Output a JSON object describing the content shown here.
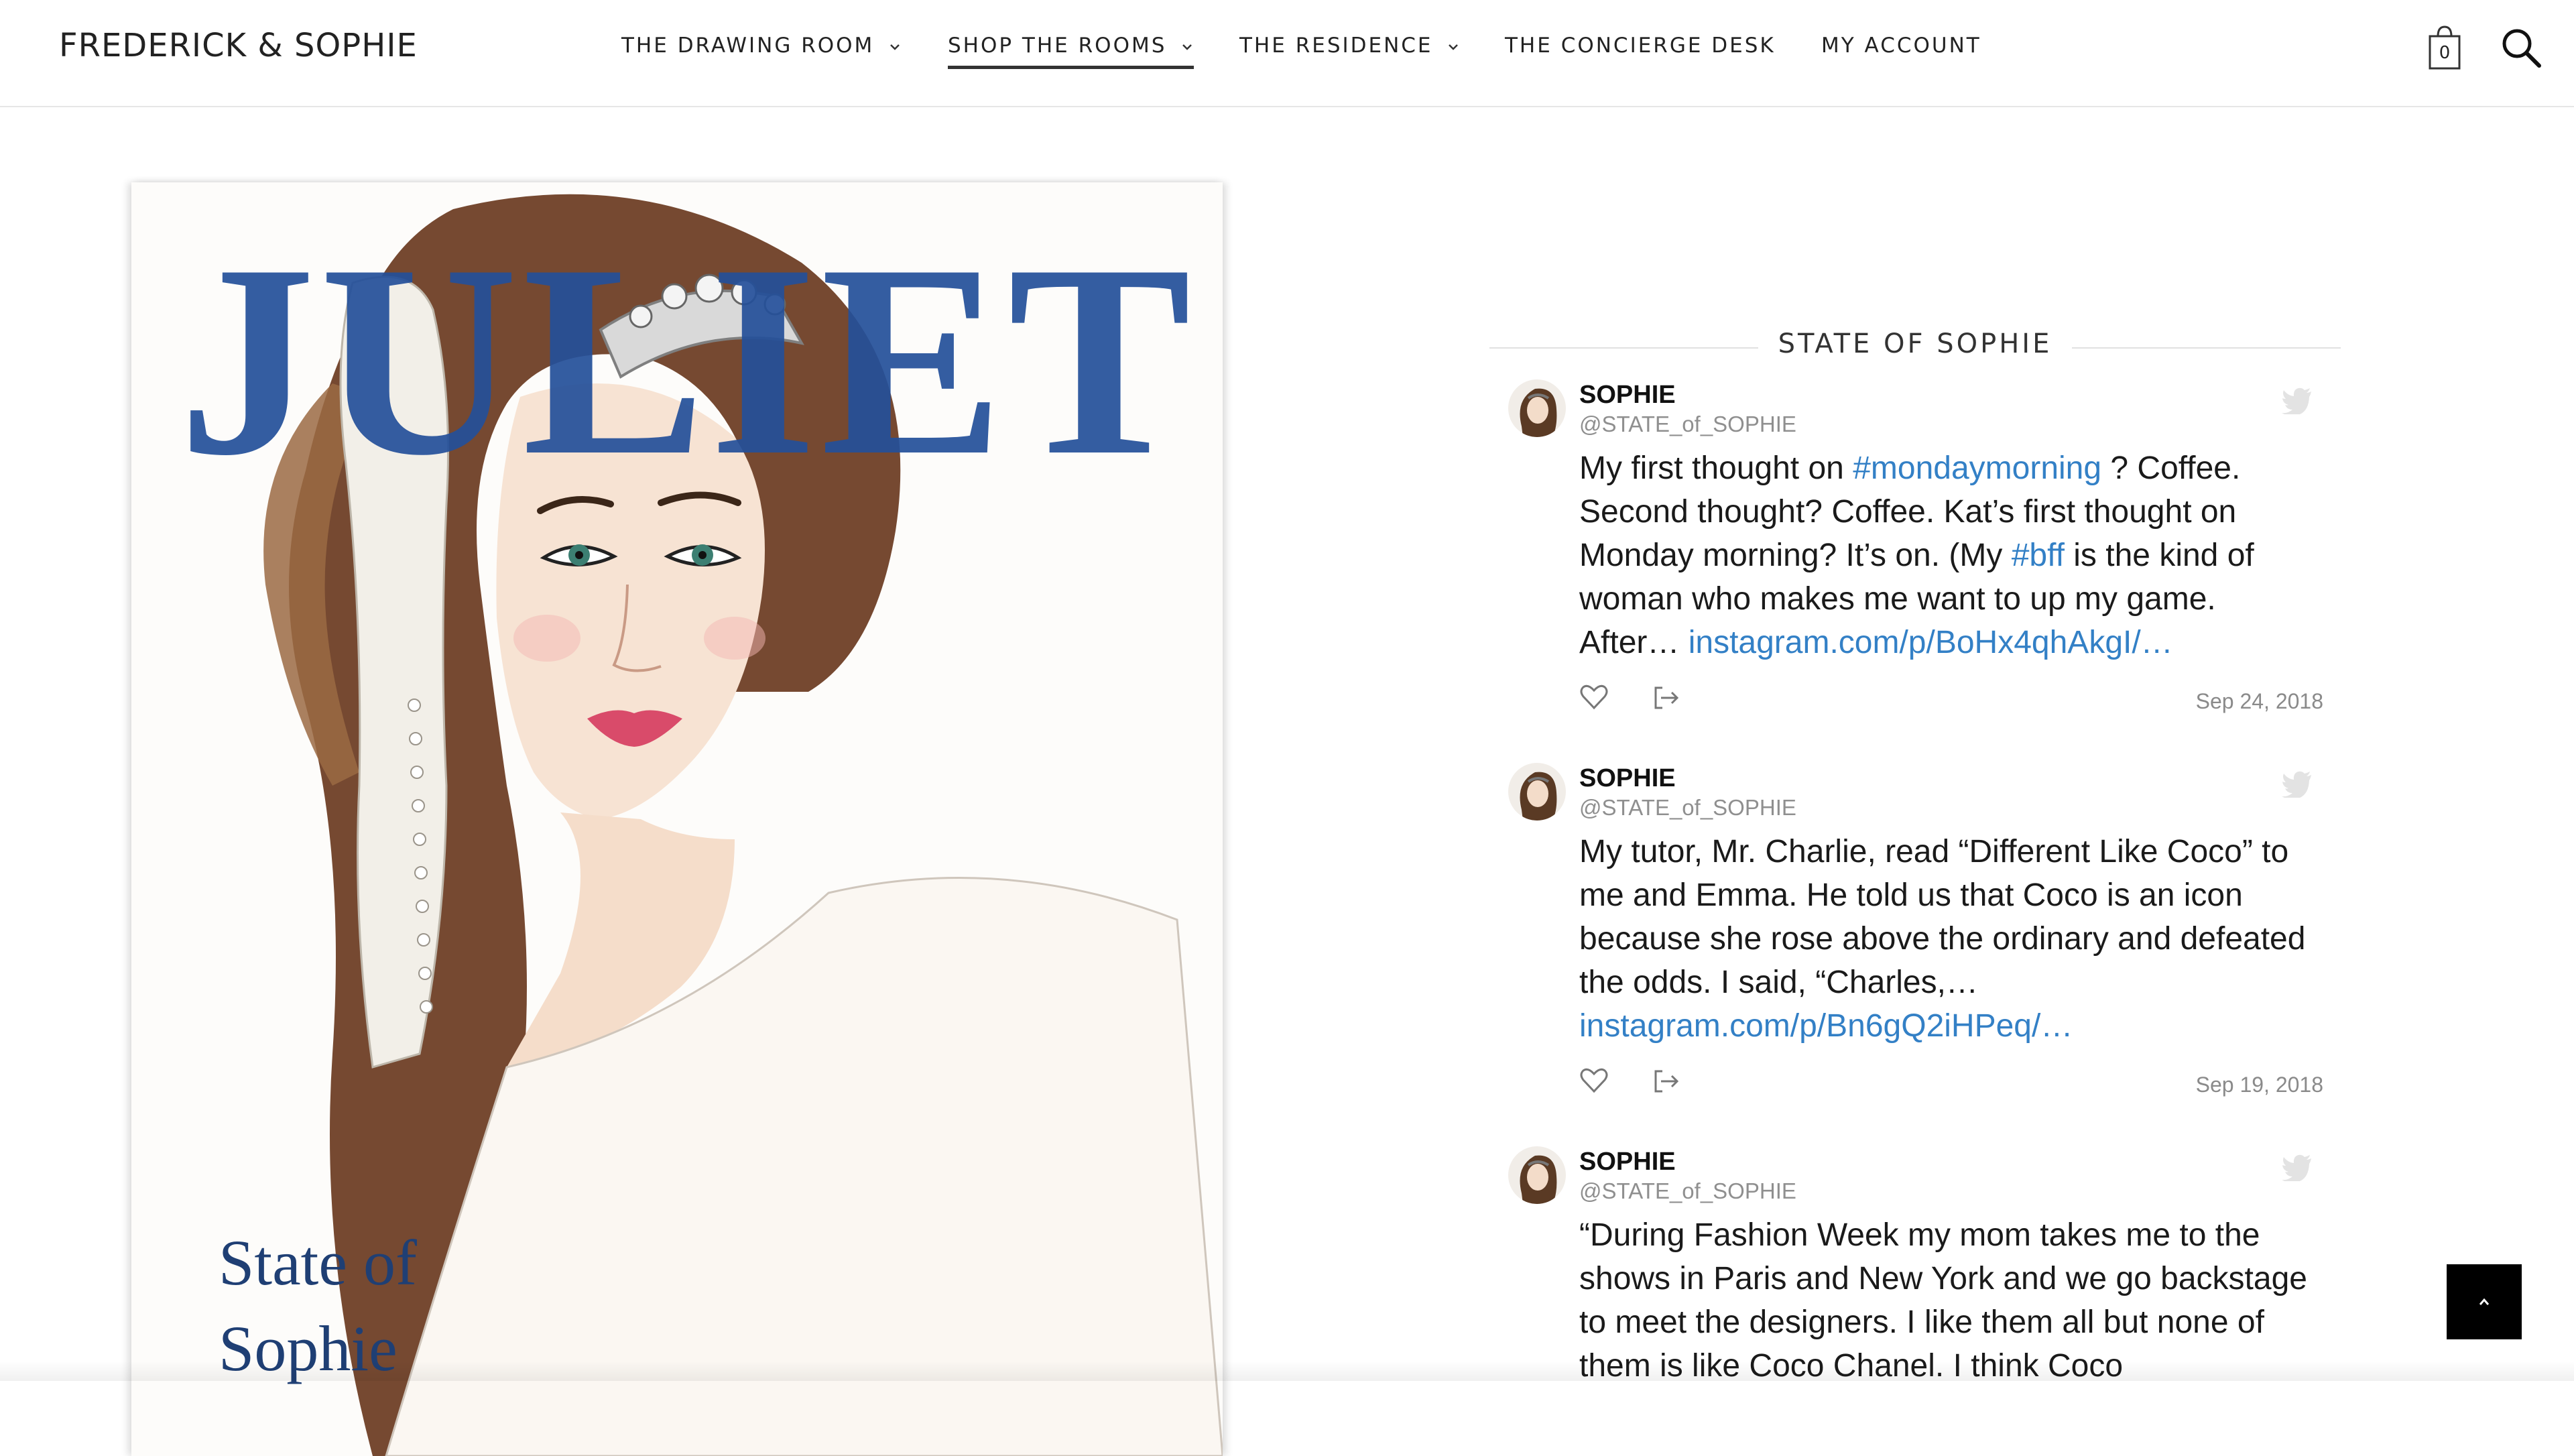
{
  "header": {
    "brand": "FREDERICK & SOPHIE",
    "nav": [
      {
        "label": "THE DRAWING ROOM",
        "has_menu": true,
        "active": false
      },
      {
        "label": "SHOP THE ROOMS",
        "has_menu": true,
        "active": true
      },
      {
        "label": "THE RESIDENCE",
        "has_menu": true,
        "active": false
      },
      {
        "label": "THE CONCIERGE DESK",
        "has_menu": false,
        "active": false
      },
      {
        "label": "MY ACCOUNT",
        "has_menu": false,
        "active": false
      }
    ],
    "cart_count": "0",
    "icons": {
      "cart": "shopping-bag-icon",
      "search": "search-icon"
    }
  },
  "cover": {
    "title": "JULIET",
    "subtitle_line1": "State of",
    "subtitle_line2": "Sophie",
    "colors": {
      "title": "#24509a",
      "hair": "#6a3a1f",
      "lips": "#d94b6a",
      "eyes": "#3c7f72"
    }
  },
  "feed": {
    "title": "STATE OF SOPHIE",
    "tweets": [
      {
        "name": "SOPHIE",
        "handle": "@STATE_of_SOPHIE",
        "text_parts": [
          {
            "kind": "text",
            "value": "My first thought on "
          },
          {
            "kind": "tag",
            "value": "#mondaymorning"
          },
          {
            "kind": "text",
            "value": " ? Coffee. Second thought? Coffee. Kat’s first thought on Monday morning? It’s on. (My "
          },
          {
            "kind": "tag",
            "value": "#bff"
          },
          {
            "kind": "text",
            "value": " is the kind of woman who makes me want to up my game. After… "
          },
          {
            "kind": "link",
            "value": "instagram.com/p/BoHx4qhAkgI/…"
          }
        ],
        "date": "Sep 24, 2018"
      },
      {
        "name": "SOPHIE",
        "handle": "@STATE_of_SOPHIE",
        "text_parts": [
          {
            "kind": "text",
            "value": "My tutor, Mr. Charlie, read “Different Like Coco” to me and Emma. He told us that Coco is an icon because she rose above the ordinary and defeated the odds. I said, “Charles,… "
          },
          {
            "kind": "link",
            "value": "instagram.com/p/Bn6gQ2iHPeq/…"
          }
        ],
        "date": "Sep 19, 2018"
      },
      {
        "name": "SOPHIE",
        "handle": "@STATE_of_SOPHIE",
        "text_parts": [
          {
            "kind": "text",
            "value": "“During Fashion Week my mom takes me to the shows in Paris and New York and we go backstage to meet the designers. I like them all but none of them is like Coco Chanel. I think Coco"
          }
        ],
        "date": ""
      }
    ],
    "icons": {
      "bird": "twitter-bird-icon",
      "like": "heart-icon",
      "share": "share-icon"
    },
    "colors": {
      "link": "#3380c6",
      "handle": "#8f8f8f"
    }
  },
  "back_to_top": {
    "icon": "chevron-up-icon"
  }
}
